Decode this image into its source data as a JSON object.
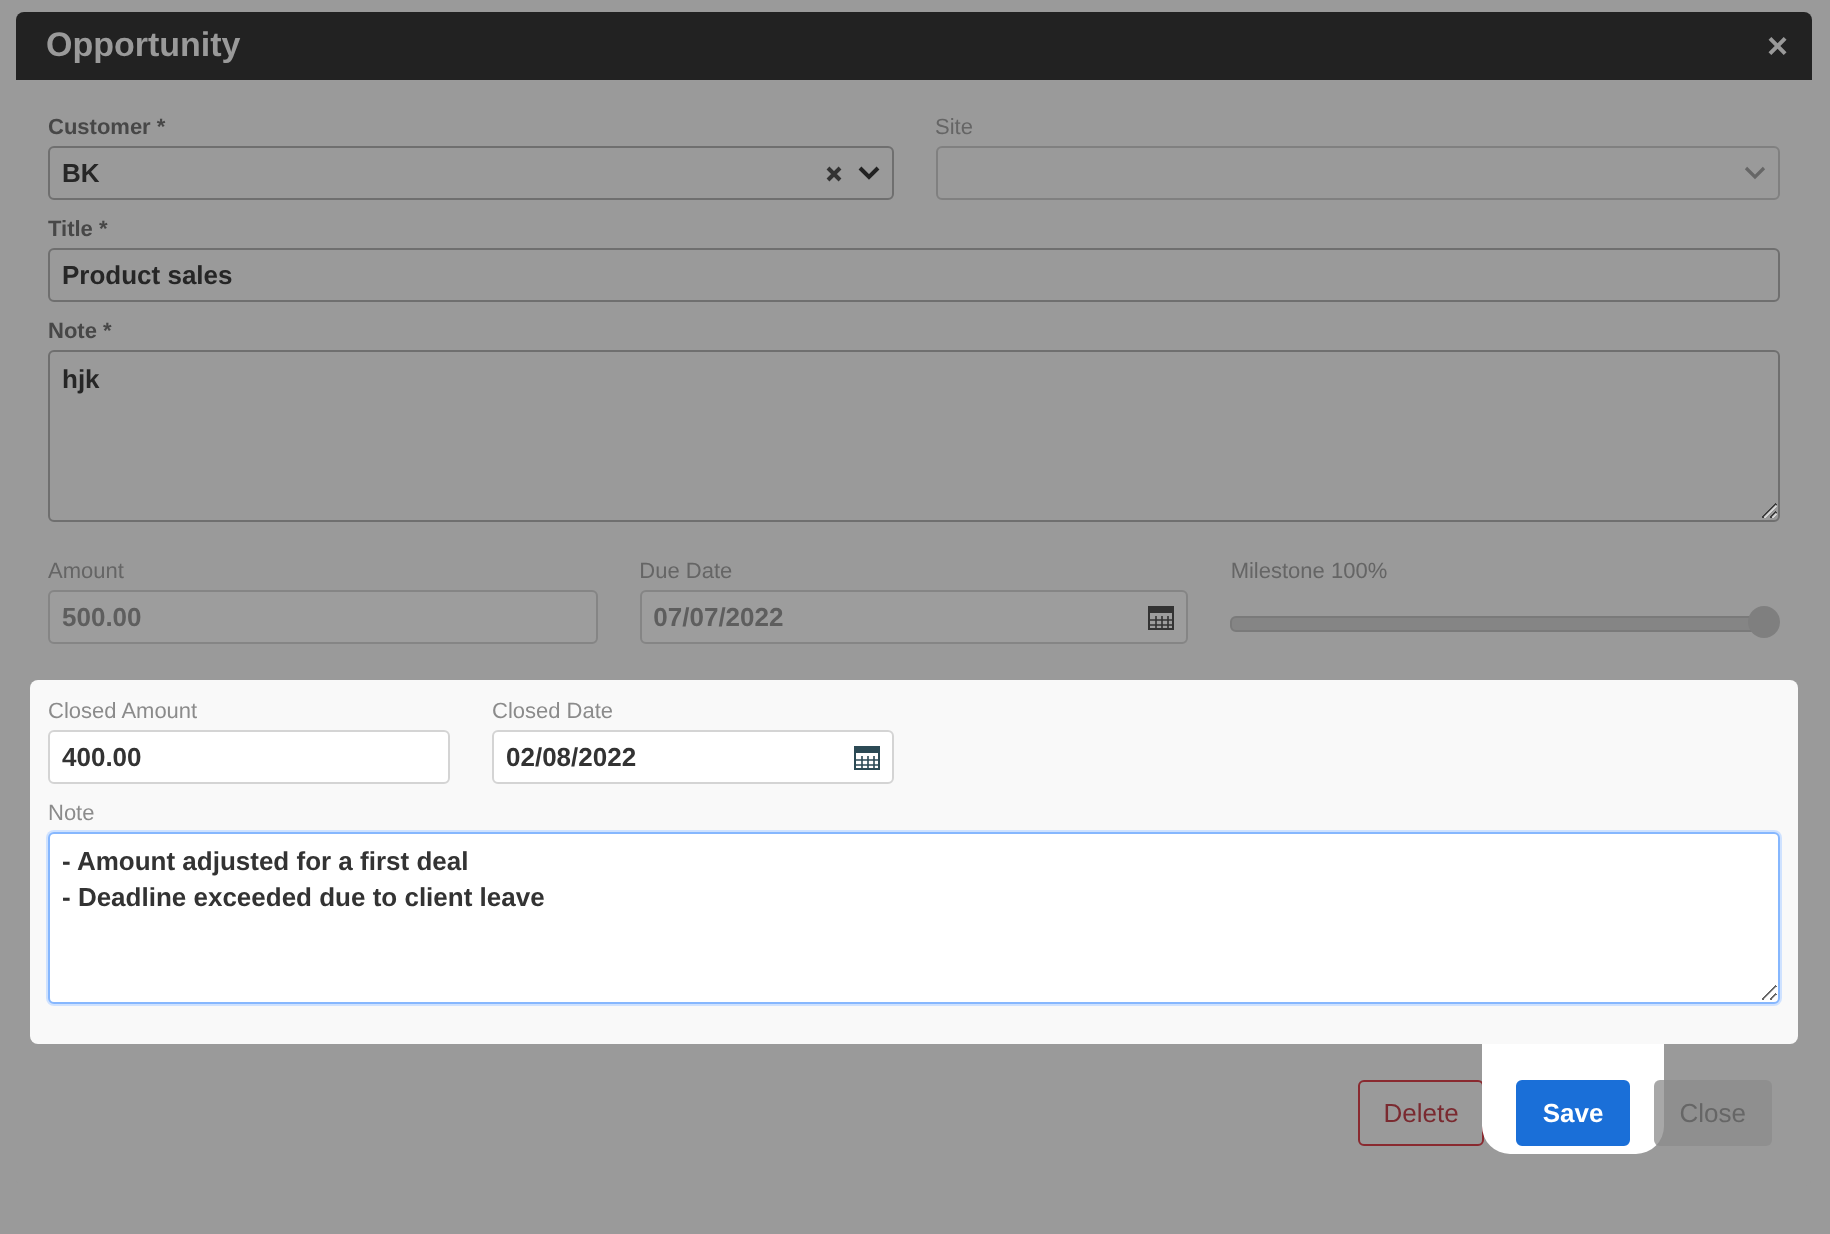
{
  "dialog": {
    "title": "Opportunity",
    "close": "×"
  },
  "customer": {
    "label": "Customer *",
    "value": "BK",
    "clearable": true
  },
  "site": {
    "label": "Site"
  },
  "title_field": {
    "label": "Title *",
    "value": "Product sales"
  },
  "note": {
    "label": "Note *",
    "value": "hjk"
  },
  "amount": {
    "label": "Amount",
    "value": "500.00",
    "disabled": true
  },
  "due_date": {
    "label": "Due Date",
    "value": "07/07/2022",
    "disabled": true
  },
  "milestone": {
    "label": "Milestone 100%",
    "level": 1
  },
  "closing": {
    "highlighted": true,
    "closed_amount": {
      "label": "Closed Amount",
      "value": "400.00"
    },
    "closed_date": {
      "label": "Closed Date",
      "value": "02/08/2022"
    },
    "note": {
      "label": "Note",
      "value": "- Amount adjusted for a first deal\n- Deadline exceeded due to client leave",
      "focused": true
    }
  },
  "buttons": [
    {
      "label": "Delete",
      "kind": "danger",
      "highlighted": false,
      "disabled": false
    },
    {
      "label": "Save",
      "kind": "primary",
      "highlighted": true,
      "disabled": false
    },
    {
      "label": "Close",
      "kind": "secondary",
      "highlighted": false,
      "disabled": true
    }
  ]
}
